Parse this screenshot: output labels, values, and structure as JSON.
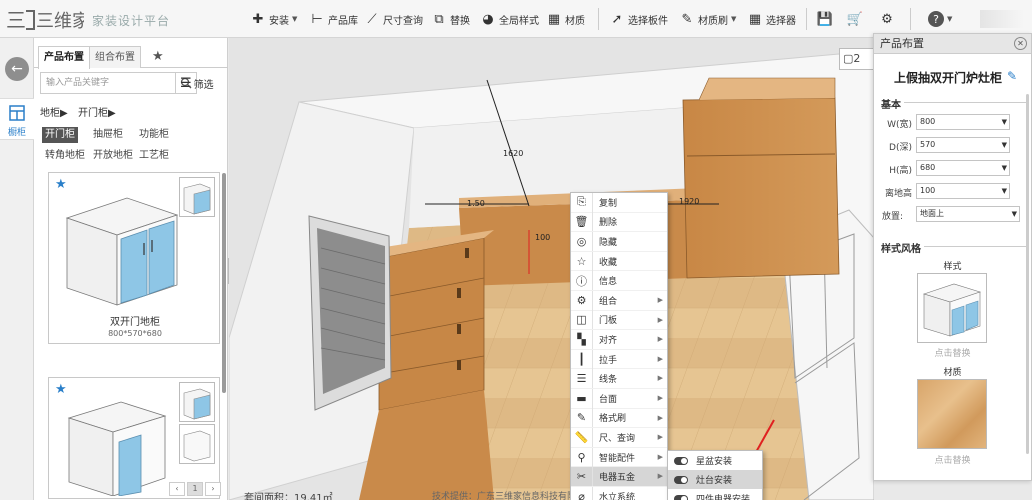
{
  "toolbar": {
    "logo_text": "三维家",
    "slogan": "家装设计平台",
    "items": [
      {
        "label": "安装",
        "icon": "plus-icon"
      },
      {
        "label": "产品库",
        "icon": "product-library-icon"
      },
      {
        "label": "尺寸查询",
        "icon": "ruler-icon"
      },
      {
        "label": "替换",
        "icon": "replace-icon"
      },
      {
        "label": "全局样式",
        "icon": "palette-icon"
      },
      {
        "label": "材质",
        "icon": "material-icon"
      },
      {
        "label": "选择板件",
        "icon": "cursor-icon"
      },
      {
        "label": "材质刷",
        "icon": "brush-icon"
      },
      {
        "label": "选择器",
        "icon": "grid-select-icon"
      }
    ]
  },
  "left_panel": {
    "tabs": [
      "产品布置",
      "组合布置"
    ],
    "search_placeholder": "输入产品关键字",
    "filter_label": "筛选",
    "crumbs": [
      "地柜▶",
      "开门柜▶"
    ],
    "categories": [
      "开门柜",
      "抽屉柜",
      "功能柜",
      "转角地柜",
      "开放地柜",
      "工艺柜"
    ],
    "cards": [
      {
        "name": "双开门地柜",
        "size": "800*570*680"
      },
      {
        "name": "",
        "size": ""
      }
    ],
    "page": "1",
    "side_tab_label": "橱柜"
  },
  "viewport": {
    "dims": [
      "1620",
      "1.50",
      "1920",
      "100"
    ],
    "area_label": "套间面积：19.41㎡",
    "tech_label": "技术提供：广东三维家信息科技有限",
    "page_label": "2"
  },
  "context_menu": {
    "items": [
      {
        "label": "复制",
        "icon": "copy-icon",
        "sub": false
      },
      {
        "label": "删除",
        "icon": "trash-icon",
        "sub": false
      },
      {
        "label": "隐藏",
        "icon": "hide-icon",
        "sub": false
      },
      {
        "label": "收藏",
        "icon": "star-icon",
        "sub": false
      },
      {
        "label": "信息",
        "icon": "info-icon",
        "sub": false
      },
      {
        "label": "组合",
        "icon": "group-icon",
        "sub": true
      },
      {
        "label": "门板",
        "icon": "door-icon",
        "sub": true
      },
      {
        "label": "对齐",
        "icon": "align-icon",
        "sub": true
      },
      {
        "label": "拉手",
        "icon": "handle-icon",
        "sub": true
      },
      {
        "label": "线条",
        "icon": "lines-icon",
        "sub": true
      },
      {
        "label": "台面",
        "icon": "countertop-icon",
        "sub": true
      },
      {
        "label": "格式刷",
        "icon": "format-brush-icon",
        "sub": true
      },
      {
        "label": "尺、查询",
        "icon": "measure-icon",
        "sub": true
      },
      {
        "label": "智能配件",
        "icon": "accessory-icon",
        "sub": true
      },
      {
        "label": "电器五金",
        "icon": "hardware-icon",
        "sub": true
      },
      {
        "label": "水立系统",
        "icon": "water-icon",
        "sub": true
      }
    ],
    "submenu": [
      "星盆安装",
      "灶台安装",
      "四件电器安装"
    ]
  },
  "right_panel": {
    "header": "产品布置",
    "product_title": "上假抽双开门炉灶柜",
    "basic_section": "基本",
    "fields": [
      {
        "label": "W(宽)",
        "value": "800"
      },
      {
        "label": "D(深)",
        "value": "570"
      },
      {
        "label": "H(高)",
        "value": "680"
      },
      {
        "label": "离地高",
        "value": "100"
      }
    ],
    "placement_label": "放置:",
    "placement_value": "地面上",
    "style_section": "样式风格",
    "style_label": "样式",
    "style_replace": "点击替换",
    "material_label": "材质",
    "material_replace": "点击替换"
  },
  "colors": {
    "wood": "#c98a4a",
    "floor": "#e2c08e",
    "wall_white": "#f4f4f4",
    "accent_blue": "#2a7fc9",
    "arrow_red": "#e02020"
  }
}
